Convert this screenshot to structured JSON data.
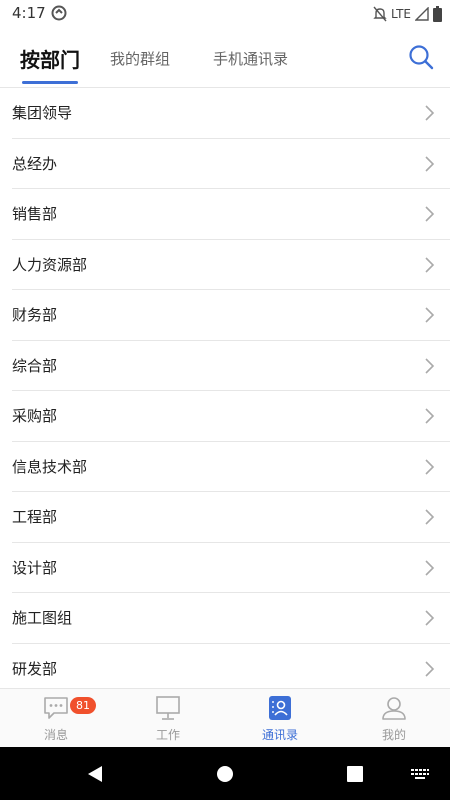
{
  "status_bar": {
    "time": "4:17",
    "network": "LTE",
    "icons": [
      "app-notification-icon",
      "mute-icon",
      "signal-icon",
      "battery-icon"
    ]
  },
  "tabs": [
    {
      "label": "按部门",
      "active": true
    },
    {
      "label": "我的群组",
      "active": false
    },
    {
      "label": "手机通讯录",
      "active": false
    }
  ],
  "departments": [
    {
      "label": "集团领导"
    },
    {
      "label": "总经办"
    },
    {
      "label": "销售部"
    },
    {
      "label": "人力资源部"
    },
    {
      "label": "财务部"
    },
    {
      "label": "综合部"
    },
    {
      "label": "采购部"
    },
    {
      "label": "信息技术部"
    },
    {
      "label": "工程部"
    },
    {
      "label": "设计部"
    },
    {
      "label": "施工图组"
    },
    {
      "label": "研发部"
    }
  ],
  "bottom_nav": [
    {
      "label": "消息",
      "icon": "message-icon",
      "badge": "81",
      "active": false
    },
    {
      "label": "工作",
      "icon": "monitor-icon",
      "active": false
    },
    {
      "label": "通讯录",
      "icon": "contacts-icon",
      "active": true
    },
    {
      "label": "我的",
      "icon": "profile-icon",
      "active": false
    }
  ],
  "colors": {
    "accent": "#3d6fd6",
    "badge": "#f0502c",
    "divider": "#e6e6e6"
  }
}
